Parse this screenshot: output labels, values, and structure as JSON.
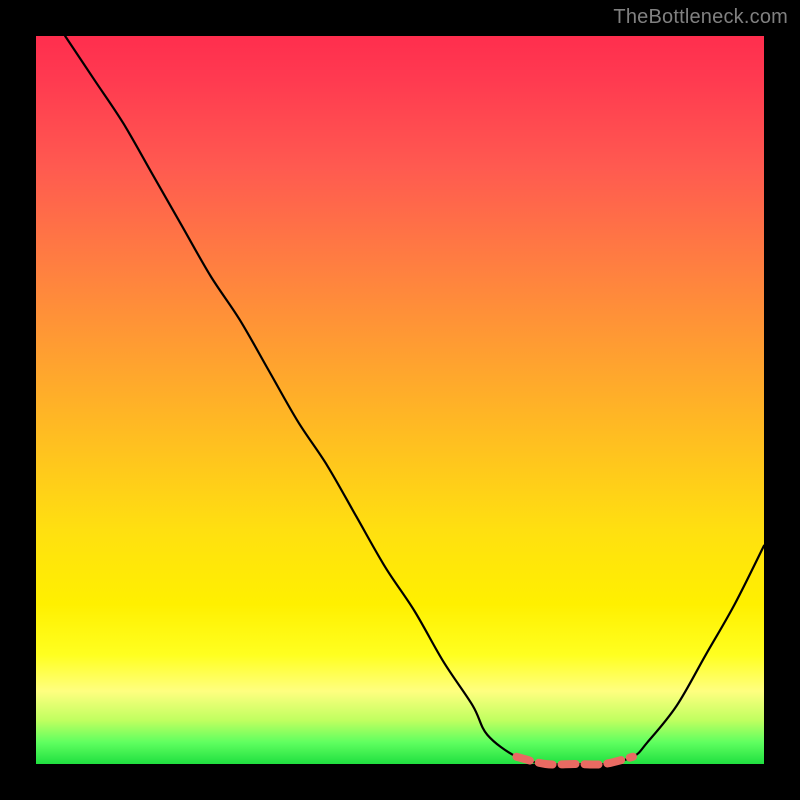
{
  "attribution": "TheBottleneck.com",
  "chart_data": {
    "type": "line",
    "title": "",
    "xlabel": "",
    "ylabel": "",
    "xlim": [
      0,
      100
    ],
    "ylim": [
      0,
      100
    ],
    "series": [
      {
        "name": "curve",
        "x": [
          4,
          8,
          12,
          16,
          20,
          24,
          28,
          32,
          36,
          40,
          44,
          48,
          52,
          56,
          60,
          62,
          66,
          70,
          74,
          78,
          82,
          84,
          88,
          92,
          96,
          100
        ],
        "values": [
          100,
          94,
          88,
          81,
          74,
          67,
          61,
          54,
          47,
          41,
          34,
          27,
          21,
          14,
          8,
          4,
          1,
          0,
          0,
          0,
          1,
          3,
          8,
          15,
          22,
          30
        ]
      }
    ],
    "highlight_range_x": [
      63,
      82
    ],
    "background": "rainbow-vertical"
  }
}
